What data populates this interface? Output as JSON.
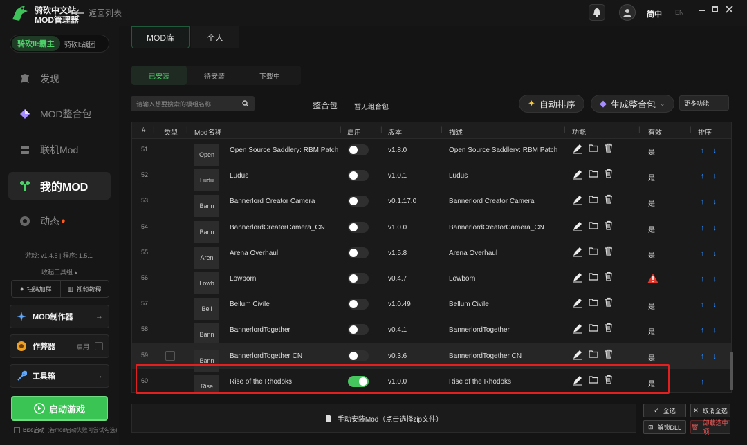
{
  "app": {
    "brand_line1": "骑砍中文站",
    "brand_line2": "MOD管理器",
    "back_label": "返回列表",
    "lang_active": "简中",
    "lang_other": "EN"
  },
  "game_switch": {
    "active": "骑砍II:霸主",
    "inactive": "骑砍I:战团"
  },
  "nav": [
    {
      "label": "发现",
      "icon": "discover-icon"
    },
    {
      "label": "MOD整合包",
      "icon": "diamond-icon"
    },
    {
      "label": "联机Mod",
      "icon": "server-icon"
    },
    {
      "label": "我的MOD",
      "icon": "tree-icon"
    },
    {
      "label": "动态",
      "icon": "chat-icon"
    }
  ],
  "sidebar": {
    "version_text": "游戏: v1.4.5 | 程序: 1.5.1",
    "collapse_label": "收起工具组 ▴",
    "qq_label": "扫码加群",
    "video_label": "视频教程",
    "mod_maker": "MOD制作器",
    "cheat": "作弊器",
    "cheat_toggle": "启用",
    "toolbox": "工具箱",
    "start": "启动游戏",
    "bise": "Bise启动",
    "bise_note": "(若mod启动失败可尝试勾选)"
  },
  "tabs": {
    "lib": "MOD库",
    "personal": "个人"
  },
  "subtabs": [
    "已安装",
    "待安装",
    "下载中"
  ],
  "search_placeholder": "请输入想要搜索的模组名称",
  "bundle_label": "整合包",
  "bundle_value": "暂无组合包",
  "auto_sort": "自动排序",
  "gen_bundle": "生成整合包",
  "more": "更多功能",
  "columns": {
    "num": "#",
    "type": "类型",
    "name": "Mod名称",
    "enabled": "启用",
    "version": "版本",
    "desc": "描述",
    "fn": "功能",
    "valid": "有效",
    "sort": "排序"
  },
  "rows": [
    {
      "num": "51",
      "type": "Open",
      "name": "Open Source Saddlery: RBM Patch",
      "enabled": false,
      "version": "v1.8.0",
      "desc": "Open Source Saddlery: RBM Patch",
      "valid": "是",
      "warn": false
    },
    {
      "num": "52",
      "type": "Ludu",
      "name": "Ludus",
      "enabled": false,
      "version": "v1.0.1",
      "desc": "Ludus",
      "valid": "是",
      "warn": false
    },
    {
      "num": "53",
      "type": "Bann",
      "name": "Bannerlord Creator Camera",
      "enabled": false,
      "version": "v0.1.17.0",
      "desc": "Bannerlord Creator Camera",
      "valid": "是",
      "warn": false
    },
    {
      "num": "54",
      "type": "Bann",
      "name": "BannerlordCreatorCamera_CN",
      "enabled": false,
      "version": "v1.0.0",
      "desc": "BannerlordCreatorCamera_CN",
      "valid": "是",
      "warn": false
    },
    {
      "num": "55",
      "type": "Aren",
      "name": "Arena Overhaul",
      "enabled": false,
      "version": "v1.5.8",
      "desc": "Arena Overhaul",
      "valid": "是",
      "warn": false
    },
    {
      "num": "56",
      "type": "Lowb",
      "name": "Lowborn",
      "enabled": false,
      "version": "v0.4.7",
      "desc": "Lowborn",
      "valid": "",
      "warn": true
    },
    {
      "num": "57",
      "type": "Bell",
      "name": "Bellum Civile",
      "enabled": false,
      "version": "v1.0.49",
      "desc": "Bellum Civile",
      "valid": "是",
      "warn": false
    },
    {
      "num": "58",
      "type": "Bann",
      "name": "BannerlordTogether",
      "enabled": false,
      "version": "v0.4.1",
      "desc": "BannerlordTogether",
      "valid": "是",
      "warn": false
    },
    {
      "num": "59",
      "type": "Bann",
      "name": "BannerlordTogether CN",
      "enabled": false,
      "version": "v0.3.6",
      "desc": "BannerlordTogether CN",
      "valid": "是",
      "warn": false
    },
    {
      "num": "60",
      "type": "Rise",
      "name": "Rise of the Rhodoks",
      "enabled": true,
      "version": "v1.0.0",
      "desc": "Rise of the Rhodoks",
      "valid": "是",
      "warn": false
    }
  ],
  "manual_install": "手动安装Mod（点击选择zip文件）",
  "select_all": "全选",
  "deselect_all": "取消全选",
  "unlock_dll": "解锁DLL",
  "uninstall": "卸载选中项"
}
